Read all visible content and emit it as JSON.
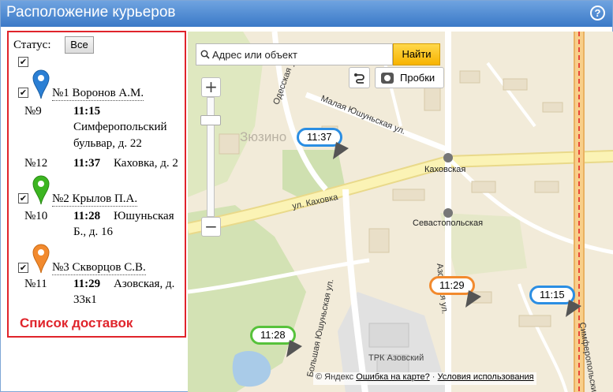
{
  "window": {
    "title": "Расположение курьеров",
    "help_label": "?"
  },
  "panel": {
    "status_label": "Статус:",
    "all_button": "Все",
    "footer": "Список доставок",
    "couriers": [
      {
        "name": "№1 Воронов А.М.",
        "pin_color": "#2b7fd4",
        "checked": "✔",
        "orders": [
          {
            "num": "№9",
            "time": "11:15",
            "address_line1": "Симферопольский",
            "address_line2": "бульвар, д. 22"
          },
          {
            "num": "№12",
            "time": "11:37",
            "address_line1": "Каховка, д. 2"
          }
        ]
      },
      {
        "name": "№2 Крылов П.А.",
        "pin_color": "#3cb521",
        "checked": "✔",
        "orders": [
          {
            "num": "№10",
            "time": "11:28",
            "address_line1": "Юшуньская",
            "address_line2": "Б., д. 16"
          }
        ]
      },
      {
        "name": "№3 Скворцов С.В.",
        "pin_color": "#f28a2e",
        "checked": "✔",
        "orders": [
          {
            "num": "№11",
            "time": "11:29",
            "address_line1": "Азовская, д.",
            "address_line2": "33к1"
          }
        ]
      }
    ],
    "all_checked": "✔"
  },
  "map": {
    "search_placeholder": "Адрес или объект",
    "find_button": "Найти",
    "traffic_button": "Пробки",
    "zoom_in": "+",
    "zoom_out": "−",
    "labels": {
      "district": "Зюзино",
      "street_malaya_yushunskaya": "Малая Юшуньская ул.",
      "street_odesskaya": "Одесская ул.",
      "street_kakhovka": "ул. Каховка",
      "metro_kakhovskaya": "Каховская",
      "metro_sevastopolskaya": "Севастопольская",
      "street_azovskaya": "Азовская ул.",
      "street_bolshaya_yushunskaya": "Большая Юшуньская ул.",
      "street_simferopolsky": "Симферопольский",
      "mall": "ТРК Азовский"
    },
    "markers": [
      {
        "time": "11:37",
        "color": "#2b8ee3"
      },
      {
        "time": "11:29",
        "color": "#f28a2e"
      },
      {
        "time": "11:15",
        "color": "#2b8ee3"
      },
      {
        "time": "11:28",
        "color": "#57c23b"
      }
    ],
    "copyright": "© Яндекс",
    "error_link": "Ошибка на карте?",
    "separator": "·",
    "terms_link": "Условия использования"
  }
}
